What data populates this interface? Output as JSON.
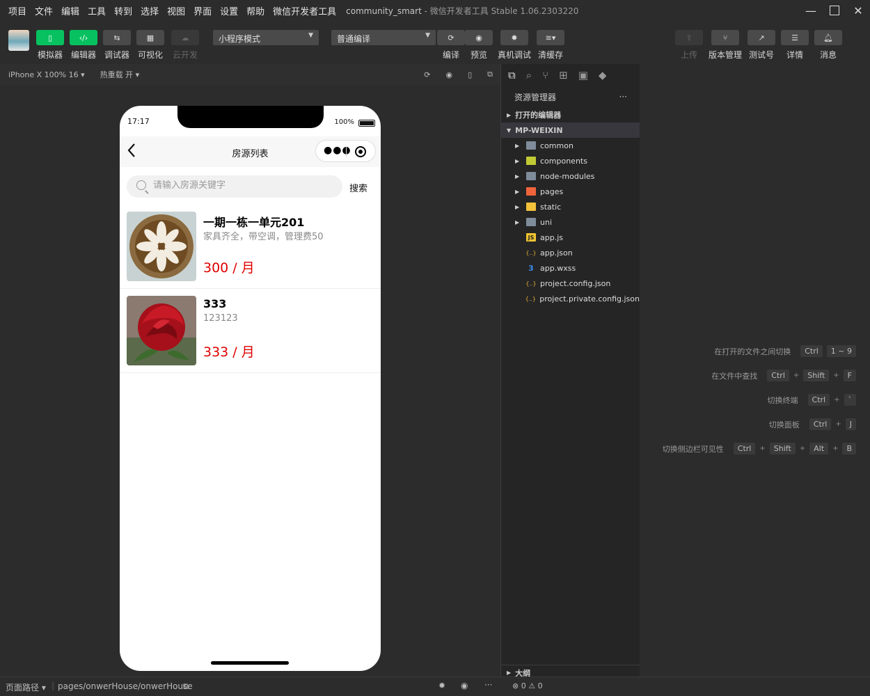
{
  "menu": [
    "项目",
    "文件",
    "编辑",
    "工具",
    "转到",
    "选择",
    "视图",
    "界面",
    "设置",
    "帮助",
    "微信开发者工具"
  ],
  "window": {
    "project": "community_smart",
    "subtitle": "- 微信开发者工具 Stable 1.06.2303220"
  },
  "toolbar": {
    "left_buttons": [
      {
        "label": "模拟器",
        "icon": "phone-icon"
      },
      {
        "label": "编辑器",
        "icon": "code-icon"
      },
      {
        "label": "调试器",
        "icon": "debug-icon"
      },
      {
        "label": "可视化",
        "icon": "layout-icon"
      },
      {
        "label": "云开发",
        "icon": "cloud-icon"
      }
    ],
    "mode_select": "小程序模式",
    "compile_select": "普通编译",
    "mid_buttons": [
      {
        "label": "编译",
        "icon": "refresh-icon"
      },
      {
        "label": "预览",
        "icon": "eye-icon"
      },
      {
        "label": "真机调试",
        "icon": "bug-icon"
      },
      {
        "label": "清缓存",
        "icon": "layers-icon"
      }
    ],
    "right_buttons": [
      {
        "label": "上传",
        "icon": "upload-icon"
      },
      {
        "label": "版本管理",
        "icon": "branch-icon"
      },
      {
        "label": "测试号",
        "icon": "external-icon"
      },
      {
        "label": "详情",
        "icon": "menu-icon"
      },
      {
        "label": "消息",
        "icon": "bell-icon"
      }
    ]
  },
  "simbar": {
    "device": "iPhone X 100% 16 ▾",
    "hotreload": "热重载 开 ▾"
  },
  "phone": {
    "time": "17:17",
    "battery": "100%",
    "nav_title": "房源列表",
    "search_placeholder": "请输入房源关键字",
    "search_button": "搜索",
    "listings": [
      {
        "title": "一期一栋一单元201",
        "desc": "家具齐全，带空调，管理费50",
        "price": "300 / 月",
        "image": "latte-art"
      },
      {
        "title": "333",
        "desc": "123123",
        "price": "333 / 月",
        "image": "red-rose"
      }
    ],
    "price_color": "#e00000"
  },
  "explorer": {
    "header": "资源管理器",
    "more": "···",
    "open_editors": "打开的编辑器",
    "project": "MP-WEIXIN",
    "folders": [
      {
        "name": "common",
        "icon": "folder-icon",
        "color": "#7f8c9a"
      },
      {
        "name": "components",
        "icon": "folder-components-icon",
        "color": "#c0ca33"
      },
      {
        "name": "node-modules",
        "icon": "folder-icon",
        "color": "#7f8c9a"
      },
      {
        "name": "pages",
        "icon": "folder-pages-icon",
        "color": "#f0643c"
      },
      {
        "name": "static",
        "icon": "folder-static-icon",
        "color": "#f3c13a"
      },
      {
        "name": "uni",
        "icon": "folder-icon",
        "color": "#7f8c9a"
      }
    ],
    "files": [
      {
        "name": "app.js",
        "icon": "js-icon",
        "glyph": "JS",
        "color": "#f0c330"
      },
      {
        "name": "app.json",
        "icon": "json-icon",
        "glyph": "{..}",
        "color": "#e8b030"
      },
      {
        "name": "app.wxss",
        "icon": "css-icon",
        "glyph": "3",
        "color": "#3d8be8"
      },
      {
        "name": "project.config.json",
        "icon": "json-icon",
        "glyph": "{..}",
        "color": "#e8b030"
      },
      {
        "name": "project.private.config.json",
        "icon": "json-icon",
        "glyph": "{..}",
        "color": "#e8b030"
      }
    ],
    "outline": "大纲"
  },
  "shortcuts": [
    {
      "label": "在打开的文件之间切换",
      "keys": [
        "Ctrl",
        "1 ~ 9"
      ]
    },
    {
      "label": "在文件中查找",
      "keys": [
        "Ctrl",
        "Shift",
        "F"
      ]
    },
    {
      "label": "切换终端",
      "keys": [
        "Ctrl",
        "`"
      ]
    },
    {
      "label": "切换面板",
      "keys": [
        "Ctrl",
        "J"
      ]
    },
    {
      "label": "切换侧边栏可见性",
      "keys": [
        "Ctrl",
        "Shift",
        "Alt",
        "B"
      ]
    }
  ],
  "statusbar": {
    "path_label": "页面路径 ▾",
    "path": "pages/onwerHouse/onwerHouse",
    "errors": "0",
    "warnings": "0"
  }
}
